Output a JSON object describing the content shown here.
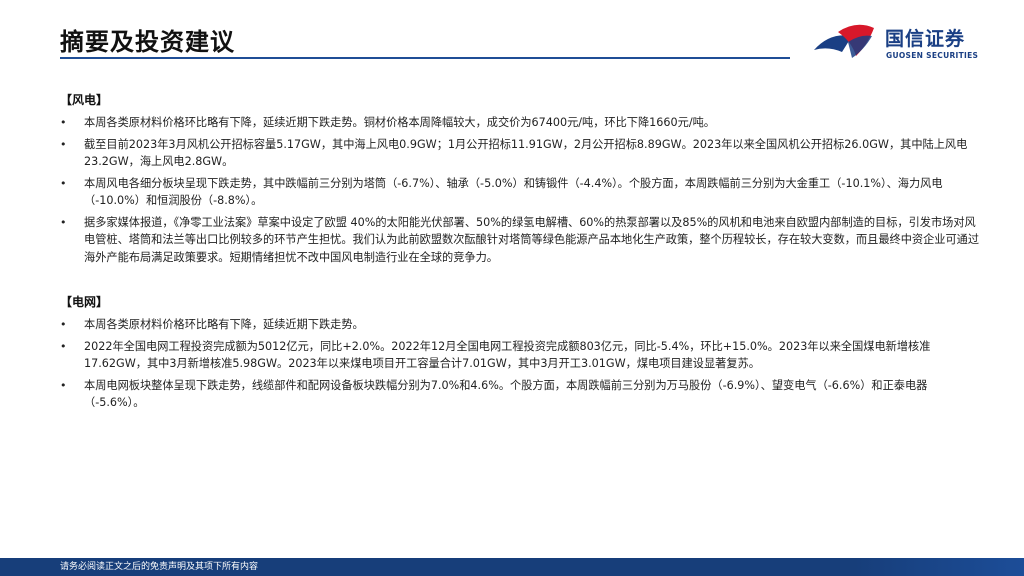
{
  "header": {
    "title": "摘要及投资建议",
    "logo_cn": "国信证券",
    "logo_en": "GUOSEN SECURITIES"
  },
  "sections": [
    {
      "heading": "【风电】",
      "items": [
        "本周各类原材料价格环比略有下降，延续近期下跌走势。铜材价格本周降幅较大，成交价为67400元/吨，环比下降1660元/吨。",
        "截至目前2023年3月风机公开招标容量5.17GW，其中海上风电0.9GW；1月公开招标11.91GW，2月公开招标8.89GW。2023年以来全国风机公开招标26.0GW，其中陆上风电23.2GW，海上风电2.8GW。",
        "本周风电各细分板块呈现下跌走势，其中跌幅前三分别为塔筒（-6.7%）、轴承（-5.0%）和铸锻件（-4.4%）。个股方面，本周跌幅前三分别为大金重工（-10.1%）、海力风电（-10.0%）和恒润股份（-8.8%）。",
        "据多家媒体报道，《净零工业法案》草案中设定了欧盟 40%的太阳能光伏部署、50%的绿氢电解槽、60%的热泵部署以及85%的风机和电池来自欧盟内部制造的目标，引发市场对风电管桩、塔筒和法兰等出口比例较多的环节产生担忧。我们认为此前欧盟数次酝酿针对塔筒等绿色能源产品本地化生产政策，整个历程较长，存在较大变数，而且最终中资企业可通过海外产能布局满足政策要求。短期情绪担忧不改中国风电制造行业在全球的竞争力。"
      ]
    },
    {
      "heading": "【电网】",
      "items": [
        "本周各类原材料价格环比略有下降，延续近期下跌走势。",
        "2022年全国电网工程投资完成额为5012亿元，同比+2.0%。2022年12月全国电网工程投资完成额803亿元，同比-5.4%，环比+15.0%。2023年以来全国煤电新增核准17.62GW，其中3月新增核准5.98GW。2023年以来煤电项目开工容量合计7.01GW，其中3月开工3.01GW，煤电项目建设显著复苏。",
        "本周电网板块整体呈现下跌走势，线缆部件和配网设备板块跌幅分别为7.0%和4.6%。个股方面，本周跌幅前三分别为万马股份（-6.9%）、望变电气（-6.6%）和正泰电器（-5.6%）。"
      ]
    }
  ],
  "bullet_char": "•",
  "footer": {
    "text": "请务必阅读正文之后的免责声明及其项下所有内容"
  },
  "colors": {
    "brand_blue": "#1a3f84",
    "brand_red": "#d7182a",
    "footer_bg": "#173e7a"
  }
}
